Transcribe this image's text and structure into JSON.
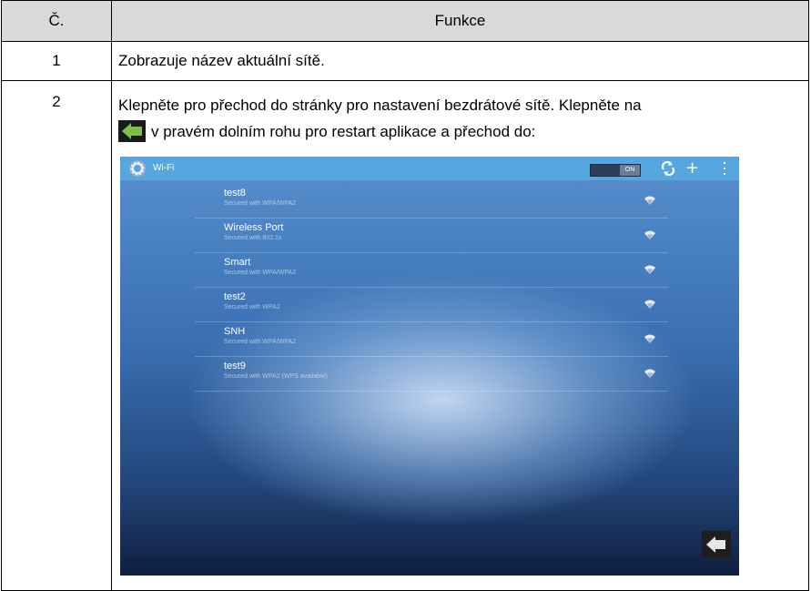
{
  "table": {
    "header": {
      "col1": "Č.",
      "col2": "Funkce"
    },
    "rows": [
      {
        "num": "1",
        "text": "Zobrazuje název aktuální sítě."
      },
      {
        "num": "2",
        "text_line1": "Klepněte pro přechod do stránky pro nastavení bezdrátové sítě. Klepněte na",
        "text_line2": "v pravém dolním rohu pro restart aplikace a přechod do:"
      }
    ]
  },
  "screenshot": {
    "title": "Wi-Fi",
    "toggle_label": "ON",
    "networks": [
      {
        "name": "test8",
        "security": "Secured with WPA/WPA2"
      },
      {
        "name": "Wireless Port",
        "security": "Secured with 802.1x"
      },
      {
        "name": "Smart",
        "security": "Secured with WPA/WPA2"
      },
      {
        "name": "test2",
        "security": "Secured with WPA2"
      },
      {
        "name": "SNH",
        "security": "Secured with WPA/WPA2"
      },
      {
        "name": "test9",
        "security": "Secured with WPA2 (WPS available)"
      }
    ],
    "colors": {
      "topbar": "#56a6e0",
      "header_bg": "#d9d9d9"
    }
  }
}
